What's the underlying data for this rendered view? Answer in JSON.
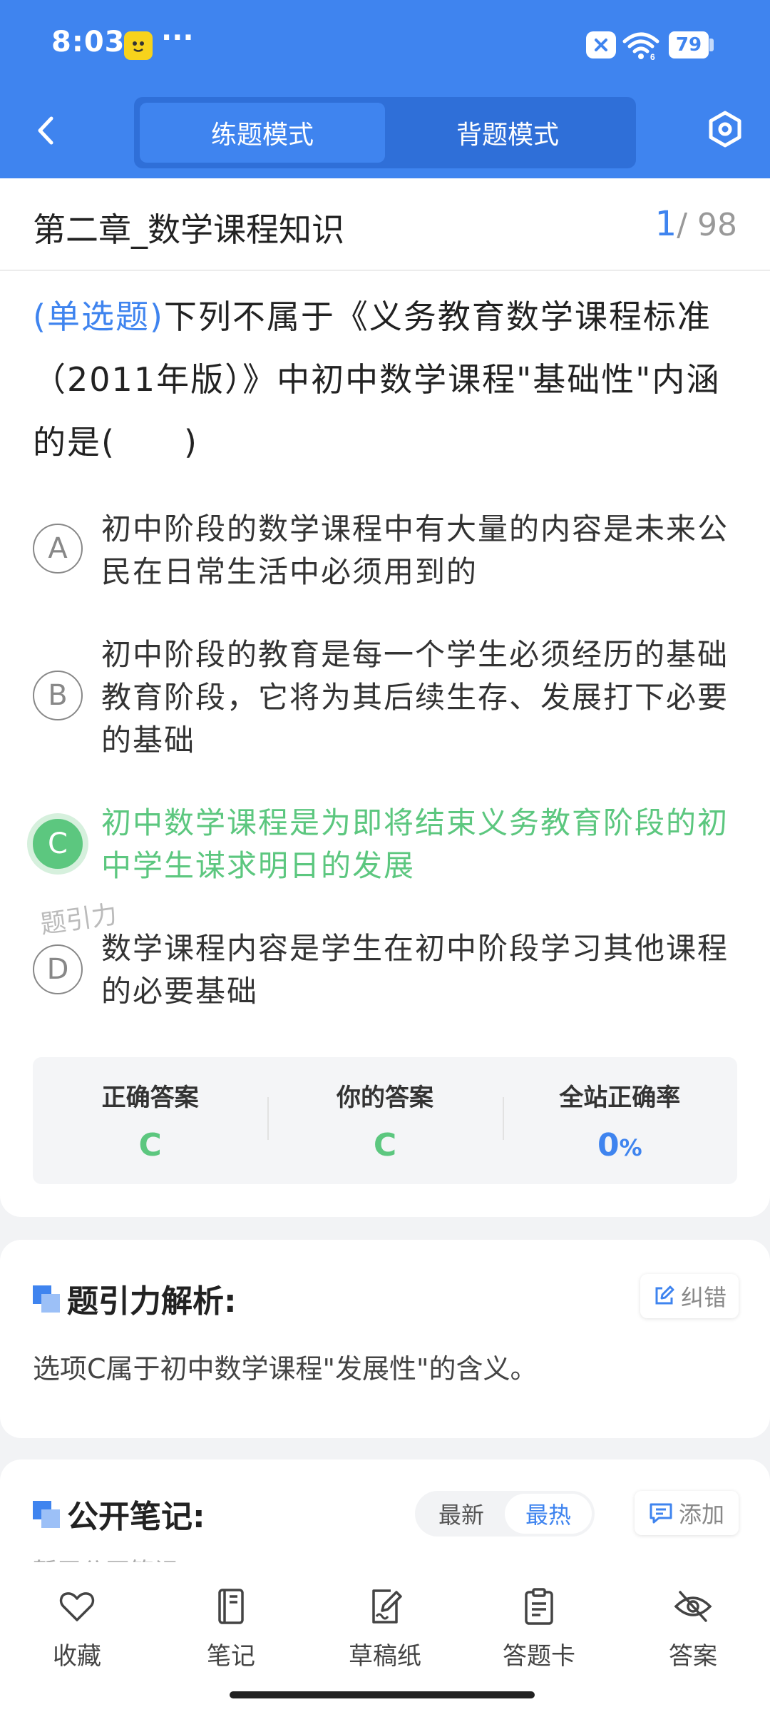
{
  "status_bar": {
    "time": "8:03",
    "app_badge": "嘟嘟",
    "more": "···",
    "battery": "79"
  },
  "header": {
    "modes": [
      "练题模式",
      "背题模式"
    ],
    "active_mode": 0
  },
  "chapter": {
    "title": "第二章_数学课程知识",
    "current": "1",
    "total": "/ 98"
  },
  "question": {
    "type": "(单选题)",
    "text": "下列不属于《义务教育数学课程标准（2011年版）》中初中数学课程\"基础性\"内涵的是(　　)"
  },
  "options": [
    {
      "letter": "A",
      "text": "初中阶段的数学课程中有大量的内容是未来公民在日常生活中必须用到的"
    },
    {
      "letter": "B",
      "text": "初中阶段的教育是每一个学生必须经历的基础教育阶段，它将为其后续生存、发展打下必要的基础"
    },
    {
      "letter": "C",
      "text": "初中数学课程是为即将结束义务教育阶段的初中学生谋求明日的发展"
    },
    {
      "letter": "D",
      "text": "数学课程内容是学生在初中阶段学习其他课程的必要基础"
    }
  ],
  "watermark": "题引力",
  "answer_summary": {
    "correct_label": "正确答案",
    "correct_value": "C",
    "yours_label": "你的答案",
    "yours_value": "C",
    "rate_label": "全站正确率",
    "rate_value": "0",
    "rate_unit": "%"
  },
  "analysis": {
    "title": "题引力解析:",
    "report_label": "纠错",
    "text": "选项C属于初中数学课程\"发展性\"的含义。"
  },
  "notes": {
    "title": "公开笔记:",
    "sort": [
      "最新",
      "最热"
    ],
    "active_sort": 1,
    "add_label": "添加",
    "empty_text": "暂无公开笔记"
  },
  "bottom_nav": [
    {
      "label": "收藏",
      "icon": "heart-icon"
    },
    {
      "label": "笔记",
      "icon": "notebook-icon"
    },
    {
      "label": "草稿纸",
      "icon": "draft-icon"
    },
    {
      "label": "答题卡",
      "icon": "clipboard-icon"
    },
    {
      "label": "答案",
      "icon": "eye-off-icon"
    }
  ],
  "colors": {
    "primary": "#3f84ef",
    "correct": "#5cc77f"
  }
}
